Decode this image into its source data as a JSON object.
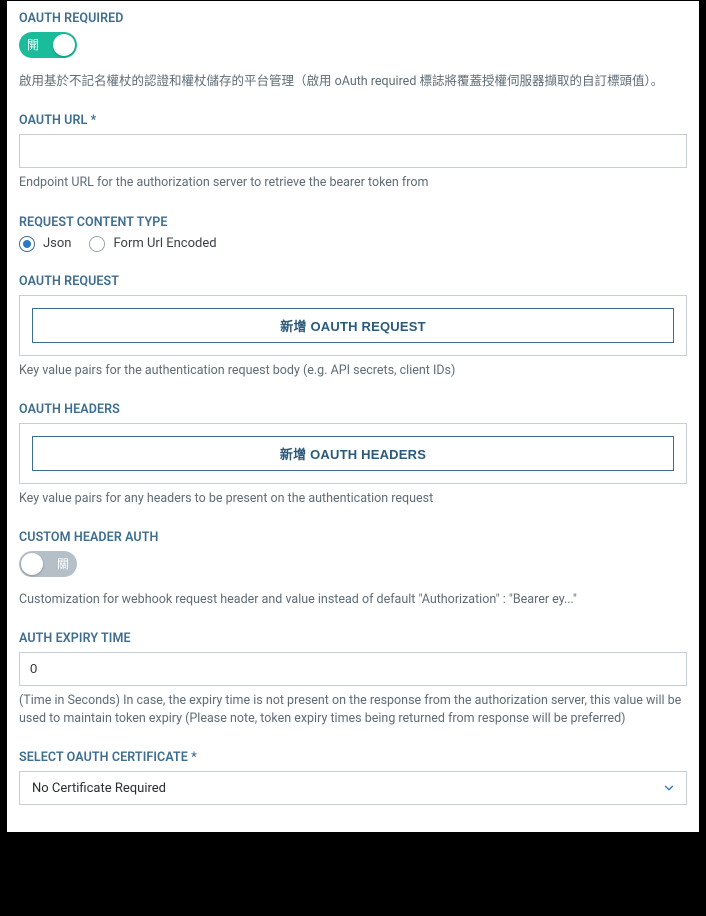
{
  "colors": {
    "accent": "#1abc9c",
    "primary_text": "#3d6d8f",
    "helper_text": "#5f6c76",
    "outline_button": "#2b5a7a",
    "select_chevron": "#2b79c2"
  },
  "oauth_required": {
    "label": "OAUTH REQUIRED",
    "toggle_on_text": "開",
    "toggled_on": true,
    "helper": "啟用基於不記名權杖的認證和權杖儲存的平台管理（啟用 oAuth required 標誌將覆蓋授權伺服器擷取的自訂標頭值）。"
  },
  "oauth_url": {
    "label": "OAUTH URL *",
    "value": "",
    "helper": "Endpoint URL for the authorization server to retrieve the bearer token from"
  },
  "request_content_type": {
    "label": "REQUEST CONTENT TYPE",
    "options": [
      {
        "value": "json",
        "label": "Json",
        "selected": true
      },
      {
        "value": "form",
        "label": "Form Url Encoded",
        "selected": false
      }
    ]
  },
  "oauth_request": {
    "label": "OAUTH REQUEST",
    "add_label": "新增 OAUTH REQUEST",
    "helper": "Key value pairs for the authentication request body (e.g. API secrets, client IDs)"
  },
  "oauth_headers": {
    "label": "OAUTH HEADERS",
    "add_label": "新增 OAUTH HEADERS",
    "helper": "Key value pairs for any headers to be present on the authentication request"
  },
  "custom_header_auth": {
    "label": "CUSTOM HEADER AUTH",
    "toggle_off_text": "關",
    "toggled_on": false,
    "helper": "Customization for webhook request header and value instead of default \"Authorization\" : \"Bearer ey...\""
  },
  "auth_expiry_time": {
    "label": "AUTH EXPIRY TIME",
    "value": "0",
    "helper": "(Time in Seconds) In case, the expiry time is not present on the response from the authorization server, this value will be used to maintain token expiry (Please note, token expiry times being returned from response will be preferred)"
  },
  "select_oauth_certificate": {
    "label": "SELECT OAUTH CERTIFICATE *",
    "selected": "No Certificate Required"
  }
}
